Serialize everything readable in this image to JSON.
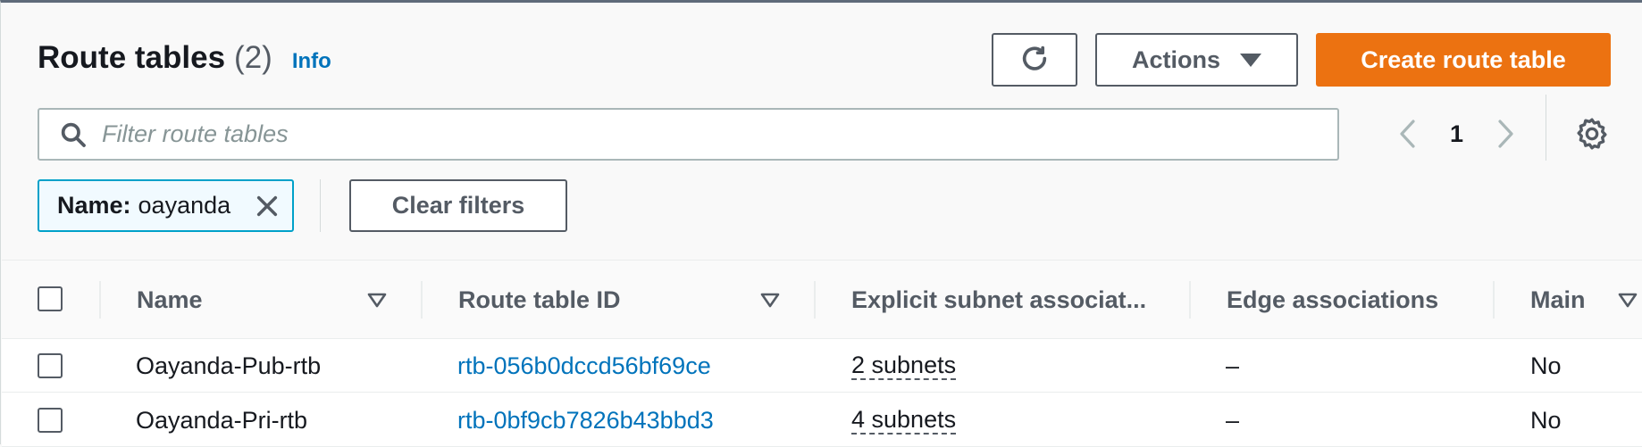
{
  "header": {
    "title": "Route tables",
    "count": "(2)",
    "info_link": "Info",
    "actions_label": "Actions",
    "create_label": "Create route table"
  },
  "filter": {
    "placeholder": "Filter route tables",
    "value": "",
    "token_key": "Name:",
    "token_value": "oayanda",
    "clear_label": "Clear filters"
  },
  "pagination": {
    "current_page": "1"
  },
  "table": {
    "columns": [
      "Name",
      "Route table ID",
      "Explicit subnet associat...",
      "Edge associations",
      "Main"
    ],
    "rows": [
      {
        "name": "Oayanda-Pub-rtb",
        "id": "rtb-056b0dccd56bf69ce",
        "subnets": "2 subnets",
        "edge": "–",
        "main": "No"
      },
      {
        "name": "Oayanda-Pri-rtb",
        "id": "rtb-0bf9cb7826b43bbd3",
        "subnets": "4 subnets",
        "edge": "–",
        "main": "No"
      }
    ]
  },
  "colors": {
    "primary_button": "#ec7211",
    "link": "#0073bb",
    "token_border": "#00a1c9",
    "token_background": "#f1faff"
  },
  "icons": [
    "refresh-icon",
    "caret-down-icon",
    "search-icon",
    "chevron-left-icon",
    "chevron-right-icon",
    "gear-icon",
    "close-icon",
    "sort-icon"
  ]
}
